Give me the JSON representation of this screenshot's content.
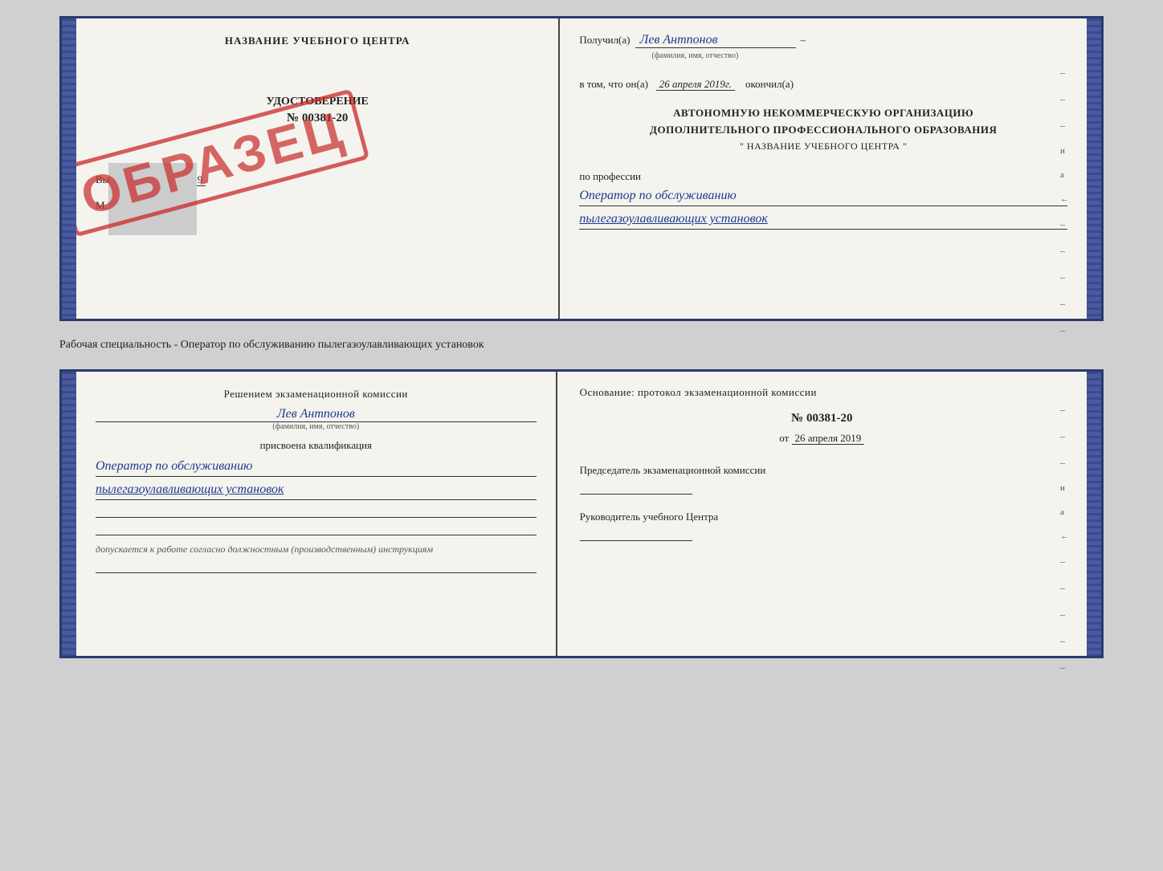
{
  "top_doc": {
    "left": {
      "header": "НАЗВАНИЕ УЧЕБНОГО ЦЕНТРА",
      "stamp_text": "ОБРАЗЕЦ",
      "certificate_type": "УДОСТОВЕРЕНИЕ",
      "certificate_number": "№ 00381-20",
      "issued_label": "Выдано",
      "issued_date": "26 апреля 2019",
      "mp_label": "М.П."
    },
    "right": {
      "received_label": "Получил(а)",
      "received_name": "Лев Антпонов",
      "name_hint": "(фамилия, имя, отчество)",
      "in_that_label": "в том, что он(а)",
      "date_value": "26 апреля 2019г.",
      "finished_label": "окончил(а)",
      "org_line1": "АВТОНОМНУЮ НЕКОММЕРЧЕСКУЮ ОРГАНИЗАЦИЮ",
      "org_line2": "ДОПОЛНИТЕЛЬНОГО ПРОФЕССИОНАЛЬНОГО ОБРАЗОВАНИЯ",
      "org_name": "\"  НАЗВАНИЕ УЧЕБНОГО ЦЕНТРА  \"",
      "profession_label": "по профессии",
      "profession_line1": "Оператор по обслуживанию",
      "profession_line2": "пылегазоулавливающих установок"
    }
  },
  "separator": {
    "text": "Рабочая специальность - Оператор по обслуживанию пылегазоулавливающих установок"
  },
  "bottom_doc": {
    "left": {
      "decision_header": "Решением экзаменационной комиссии",
      "person_name": "Лев Антпонов",
      "name_hint": "(фамилия, имя, отчество)",
      "assigned_label": "присвоена квалификация",
      "qual_line1": "Оператор по обслуживанию",
      "qual_line2": "пылегазоулавливающих установок",
      "admitted_text": "допускается к  работе согласно должностным (производственным) инструкциям"
    },
    "right": {
      "basis_label": "Основание: протокол экзаменационной комиссии",
      "protocol_number": "№ 00381-20",
      "protocol_date_prefix": "от",
      "protocol_date": "26 апреля 2019",
      "chairman_label": "Председатель экзаменационной комиссии",
      "director_label": "Руководитель учебного Центра"
    }
  }
}
